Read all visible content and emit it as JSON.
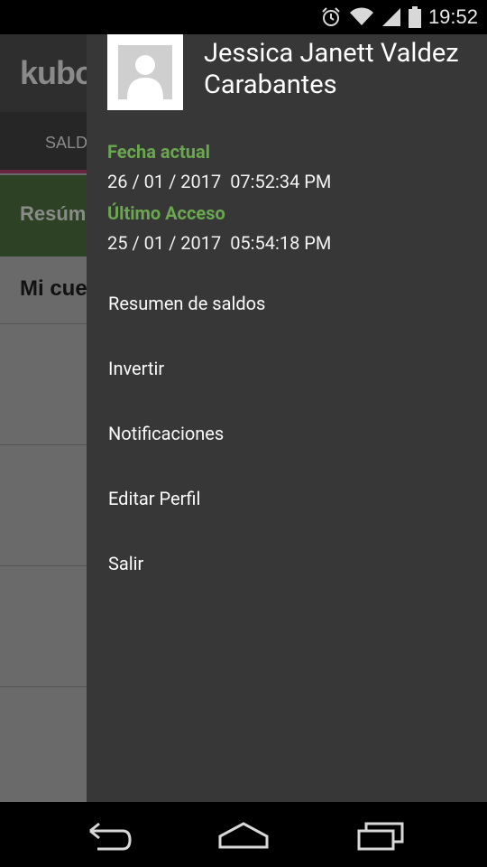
{
  "status_bar": {
    "time": "19:52"
  },
  "background_app": {
    "logo": "kubo",
    "tab_label": "SALDO",
    "section_title": "Resúmen",
    "card_title": "Mi cuenta"
  },
  "drawer": {
    "user_name_line1": "Jessica Janett Valdez",
    "user_name_line2": "Carabantes",
    "current_date_label": "Fecha actual",
    "current_date_value": "26 / 01 / 2017  07:52:34 PM",
    "last_access_label": "Último Acceso",
    "last_access_value": "25 / 01 / 2017  05:54:18 PM",
    "menu": [
      {
        "label": "Resumen de saldos"
      },
      {
        "label": "Invertir"
      },
      {
        "label": "Notificaciones"
      },
      {
        "label": "Editar Perfil"
      },
      {
        "label": "Salir"
      }
    ]
  },
  "colors": {
    "drawer_bg": "#373737",
    "accent_green": "#6aa84f",
    "scrim": "#6a6a6a"
  },
  "icons": {
    "status": [
      "alarm-icon",
      "wifi-icon",
      "signal-icon",
      "battery-icon"
    ],
    "nav": [
      "back-icon",
      "home-icon",
      "recents-icon"
    ],
    "avatar": "person-placeholder-icon"
  }
}
